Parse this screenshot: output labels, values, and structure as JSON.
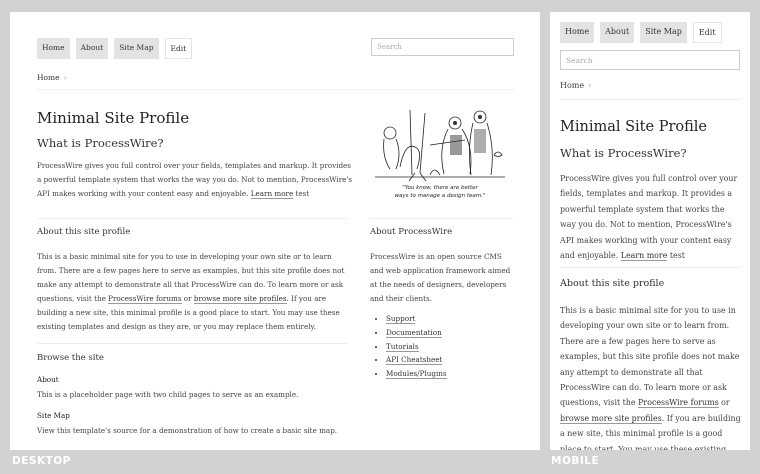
{
  "nav": {
    "home": "Home",
    "about": "About",
    "sitemap": "Site Map",
    "edit": "Edit"
  },
  "search": {
    "placeholder": "Search"
  },
  "breadcrumb": {
    "home": "Home",
    "separator": "›"
  },
  "page": {
    "title": "Minimal Site Profile",
    "subtitle": "What is ProcessWire?",
    "intro_text": "ProcessWire gives you full control over your fields, templates and markup. It provides a powerful template system that works the way you do. Not to mention, ProcessWire's API makes working with your content easy and enjoyable. ",
    "intro_link": "Learn more",
    "intro_tail": " test"
  },
  "cartoon": {
    "caption_line1": "\"You know, there are better",
    "caption_line2": "ways to manage a design team.\""
  },
  "about_site": {
    "heading": "About this site profile",
    "text_a": "This is a basic minimal site for you to use in developing your own site or to learn from. There are a few pages here to serve as examples, but this site profile does not make any attempt to demonstrate all that ProcessWire can do. To learn more or ask questions, visit the ",
    "link_forums": "ProcessWire forums",
    "text_or": " or ",
    "link_profiles": "browse more site profiles",
    "text_b": ". If you are building a new site, this minimal profile is a good place to start. You may use these existing templates and design as they are, or you may replace them entirely."
  },
  "browse": {
    "heading": "Browse the site",
    "items": [
      {
        "title": "About",
        "desc": "This is a placeholder page with two child pages to serve as an example."
      },
      {
        "title": "Site Map",
        "desc": "View this template's source for a demonstration of how to create a basic site map."
      }
    ]
  },
  "about_pw": {
    "heading": "About ProcessWire",
    "text": "ProcessWire is an open source CMS and web application framework aimed at the needs of designers, developers and their clients.",
    "links": [
      "Support",
      "Documentation",
      "Tutorials",
      "API Cheatsheet",
      "Modules/Plugins"
    ]
  },
  "labels": {
    "desktop": "DESKTOP",
    "mobile": "MOBILE"
  }
}
